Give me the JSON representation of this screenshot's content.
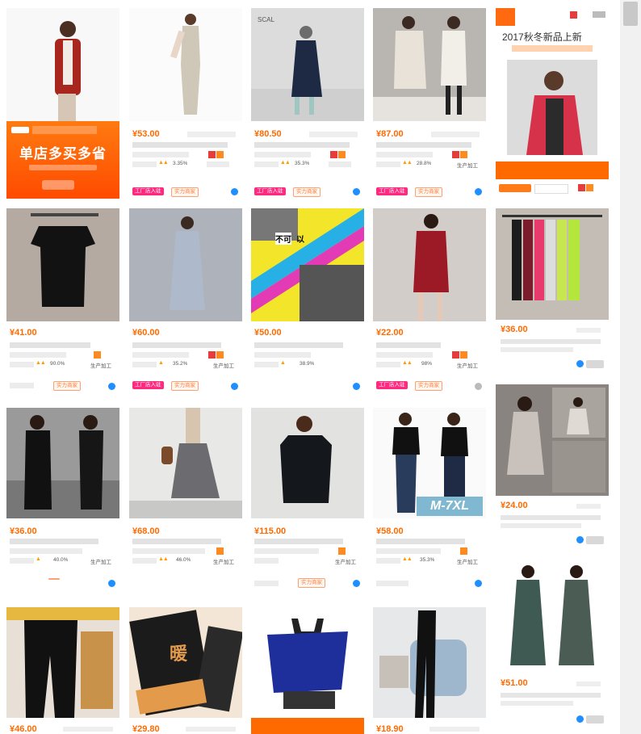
{
  "products": [
    {
      "id": "r1c1",
      "banner": {
        "badge": "",
        "subtitle": "",
        "headline": "单店多买多省",
        "sub": "",
        "button": ""
      }
    },
    {
      "id": "r1c2",
      "price": "¥53.00",
      "stat": "3.35%"
    },
    {
      "id": "r1c3",
      "price": "¥80.50",
      "stat": "35.3%",
      "img_text": "SCAL"
    },
    {
      "id": "r1c4",
      "price": "¥87.00",
      "stat": "28.8%",
      "flag": "生产加工"
    },
    {
      "id": "r1c5",
      "ad": {
        "title": "2017秋冬新品上新",
        "bar": ""
      }
    },
    {
      "id": "r2c1",
      "price": "¥41.00",
      "stat": "90.0%",
      "flag": "生产加工"
    },
    {
      "id": "r2c2",
      "price": "¥60.00",
      "stat": "35.2%",
      "flag": "生产加工"
    },
    {
      "id": "r2c3",
      "price": "¥50.00",
      "stat": "38.9%",
      "img_text": {
        "l1": "不可",
        "l2": "以",
        "l3": "",
        "l4": ""
      }
    },
    {
      "id": "r2c4",
      "price": "¥22.00",
      "stat": "98%",
      "flag": "生产加工"
    },
    {
      "id": "r2c5",
      "price": "¥36.00"
    },
    {
      "id": "r3c1",
      "price": "¥36.00",
      "stat": "40.0%",
      "flag": "生产加工"
    },
    {
      "id": "r3c2",
      "price": "¥68.00",
      "stat": "46.0%",
      "flag": "生产加工"
    },
    {
      "id": "r3c3",
      "price": "¥115.00",
      "flag": "生产加工"
    },
    {
      "id": "r3c4",
      "price": "¥58.00",
      "stat": "35.3%",
      "flag": "生产加工",
      "img_text": "M-7XL"
    },
    {
      "id": "r3c5",
      "price": "¥24.00"
    },
    {
      "id": "r4c1",
      "price": "¥46.00"
    },
    {
      "id": "r4c2",
      "price": "¥29.80",
      "img_text": "暖"
    },
    {
      "id": "r4c3",
      "price": ""
    },
    {
      "id": "r4c4",
      "price": "¥18.90"
    },
    {
      "id": "r4c5",
      "price": "¥51.00"
    }
  ],
  "tags": {
    "pink": "工厂店入驻",
    "outline": "实力商家"
  },
  "colors": {
    "accent": "#ff6a00",
    "pink_tag": "#ff2a7f",
    "wangwang": "#1f8fff"
  },
  "icons": [
    "wangwang-icon",
    "star-icon",
    "shop-badge-icon",
    "arrow-icon"
  ]
}
